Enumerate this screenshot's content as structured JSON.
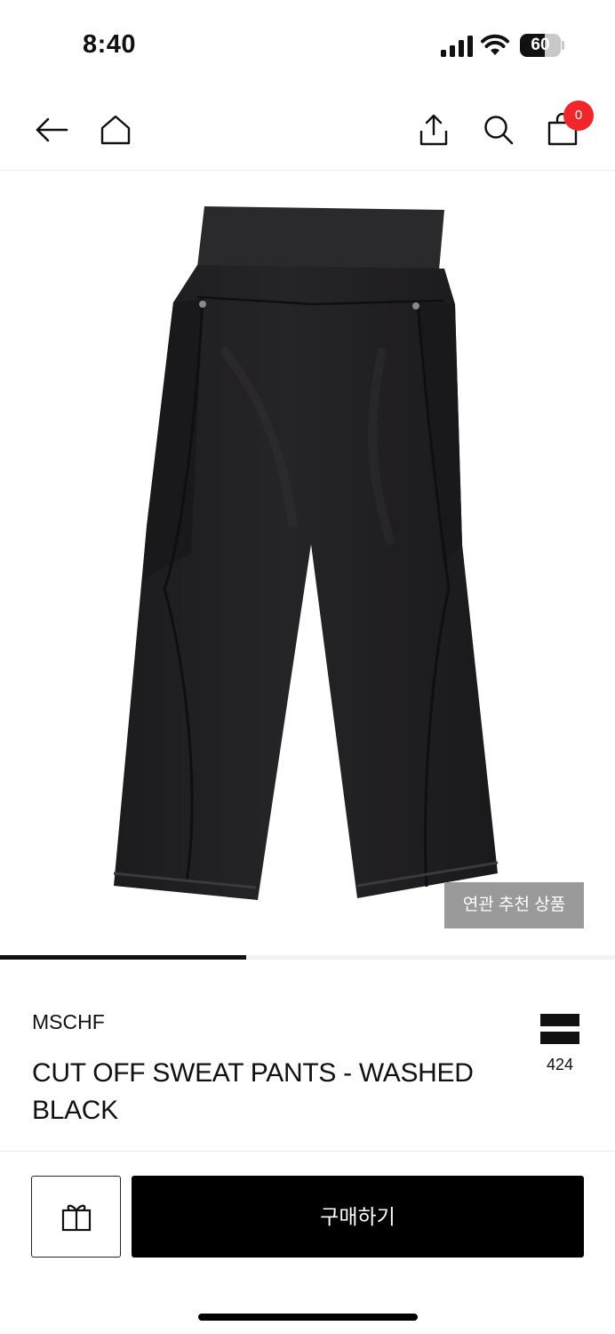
{
  "status_bar": {
    "time": "8:40",
    "battery_level": "60",
    "battery_fraction": 0.6
  },
  "nav": {
    "icons": [
      "back-arrow-icon",
      "home-icon",
      "share-icon",
      "search-icon",
      "shopping-bag-icon"
    ],
    "cart_count": "0",
    "badge_color": "#f0262b"
  },
  "gallery": {
    "related_label": "연관 추천 상품",
    "progress_fraction": 0.4
  },
  "product": {
    "brand": "MSCHF",
    "title": "CUT OFF SWEAT PANTS - WASHED BLACK",
    "like_count": "424"
  },
  "actions": {
    "gift_icon": "gift-icon",
    "buy_label": "구매하기"
  }
}
